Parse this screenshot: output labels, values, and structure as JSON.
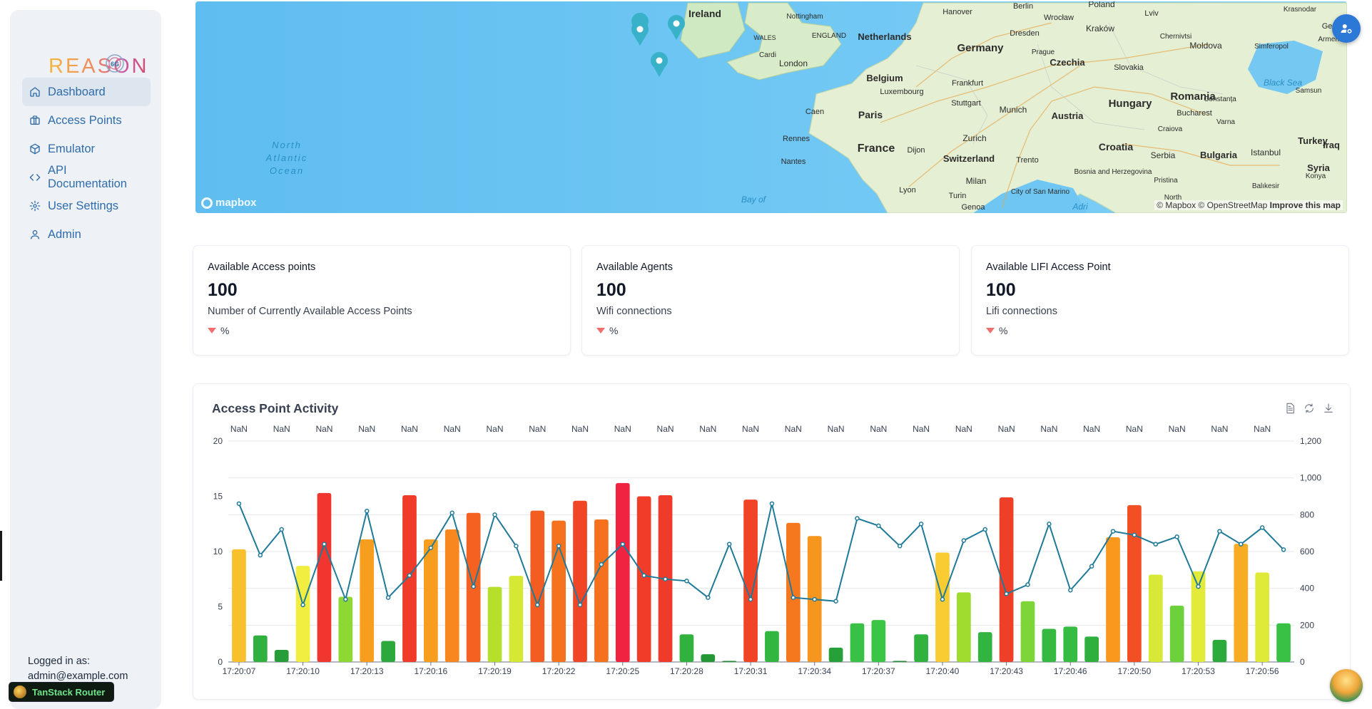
{
  "app": {
    "brand": "REASON",
    "brand_badge": "6G"
  },
  "sidebar": {
    "items": [
      {
        "label": "Dashboard",
        "icon": "home-icon",
        "active": true
      },
      {
        "label": "Access Points",
        "icon": "briefcase-icon",
        "active": false
      },
      {
        "label": "Emulator",
        "icon": "cube-icon",
        "active": false
      },
      {
        "label": "API Documentation",
        "icon": "code-icon",
        "active": false
      },
      {
        "label": "User Settings",
        "icon": "gear-icon",
        "active": false
      },
      {
        "label": "Admin",
        "icon": "user-icon",
        "active": false
      }
    ],
    "logged_in_label": "Logged in as:",
    "logged_in_user": "admin@example.com"
  },
  "devtools": {
    "label": "TanStack Router"
  },
  "map": {
    "labels": [
      "Ireland",
      "Nottingham",
      "ENGLAND",
      "WALES",
      "Cardi",
      "London",
      "Hanover",
      "Berlin",
      "Wrocław",
      "Lviv",
      "Dresden",
      "Kraków",
      "Chernivtsi",
      "Netherlands",
      "Germany",
      "Poland",
      "Moldova",
      "Simferopol",
      "Belgium",
      "Luxembourg",
      "Frankfurt",
      "Czechia",
      "Slovakia",
      "Prague",
      "Caen",
      "Paris",
      "Stuttgart",
      "Munich",
      "Austria",
      "Hungary",
      "Romania",
      "Bucharest",
      "Black Sea",
      "Rennes",
      "Nantes",
      "France",
      "Dijon",
      "Zurich",
      "Switzerland",
      "Trento",
      "Croatia",
      "Serbia",
      "Bulgaria",
      "Istanbul",
      "Turkey",
      "Lyon",
      "Milan",
      "Turin",
      "Genoa",
      "City of San Marino",
      "Bosnia and Herzegovina",
      "Pristina",
      "North",
      "Balıkesir",
      "Konya",
      "Syria",
      "Iraq",
      "Samsun",
      "Constanța",
      "Varna",
      "Craiova",
      "North Atlantic Ocean",
      "Bay of",
      "Adri",
      "Krasnodar",
      "Georg",
      "Armenia"
    ],
    "attribution": "© Mapbox © OpenStreetMap",
    "improve": "Improve this map",
    "logo": "mapbox",
    "marker_count": 3
  },
  "stats": [
    {
      "title": "Available Access points",
      "value": "100",
      "subtitle": "Number of Currently Available Access Points",
      "delta": "%"
    },
    {
      "title": "Available Agents",
      "value": "100",
      "subtitle": "Wifi connections",
      "delta": "%"
    },
    {
      "title": "Available LIFI Access Point",
      "value": "100",
      "subtitle": "Lifi connections",
      "delta": "%"
    }
  ],
  "activity": {
    "title": "Access Point Activity",
    "tools": [
      "document-icon",
      "refresh-icon",
      "download-icon"
    ]
  },
  "chart_data": {
    "type": "bar",
    "title": "Access Point Activity",
    "top_labels": [
      "NaN",
      "NaN",
      "NaN",
      "NaN",
      "NaN",
      "NaN",
      "NaN",
      "NaN",
      "NaN",
      "NaN",
      "NaN",
      "NaN",
      "NaN",
      "NaN",
      "NaN",
      "NaN",
      "NaN",
      "NaN",
      "NaN",
      "NaN",
      "NaN",
      "NaN",
      "NaN",
      "NaN",
      "NaN"
    ],
    "x_ticks": [
      "17:20:07",
      "17:20:10",
      "17:20:13",
      "17:20:16",
      "17:20:19",
      "17:20:22",
      "17:20:25",
      "17:20:28",
      "17:20:31",
      "17:20:34",
      "17:20:37",
      "17:20:40",
      "17:20:43",
      "17:20:46",
      "17:20:50",
      "17:20:53",
      "17:20:56"
    ],
    "ylim_left": [
      0,
      20
    ],
    "yticks_left": [
      "0",
      "5",
      "10",
      "15",
      "20"
    ],
    "ylim_right": [
      0,
      1200
    ],
    "yticks_right": [
      "0",
      "200",
      "400",
      "600",
      "800",
      "1,000",
      "1,200"
    ],
    "bars": [
      10.2,
      2.4,
      1.1,
      8.7,
      15.3,
      5.9,
      11.1,
      1.9,
      15.1,
      11.1,
      12.0,
      13.5,
      6.8,
      7.8,
      13.7,
      12.8,
      14.6,
      12.9,
      16.2,
      15.0,
      15.1,
      2.5,
      0.7,
      0.1,
      14.7,
      2.8,
      12.6,
      11.4,
      1.3,
      3.5,
      3.8,
      0.1,
      2.5,
      9.9,
      6.3,
      2.7,
      14.9,
      5.5,
      3.0,
      3.2,
      2.3,
      11.3,
      14.2,
      7.9,
      5.1,
      8.2,
      2.0,
      10.7,
      8.1,
      3.5
    ],
    "line": [
      860,
      580,
      720,
      310,
      640,
      340,
      820,
      350,
      470,
      620,
      810,
      410,
      800,
      630,
      310,
      630,
      310,
      530,
      640,
      470,
      450,
      440,
      350,
      640,
      340,
      860,
      350,
      340,
      330,
      780,
      740,
      630,
      750,
      340,
      660,
      720,
      370,
      420,
      750,
      390,
      520,
      710,
      690,
      640,
      680,
      410,
      710,
      640,
      730,
      610
    ]
  }
}
